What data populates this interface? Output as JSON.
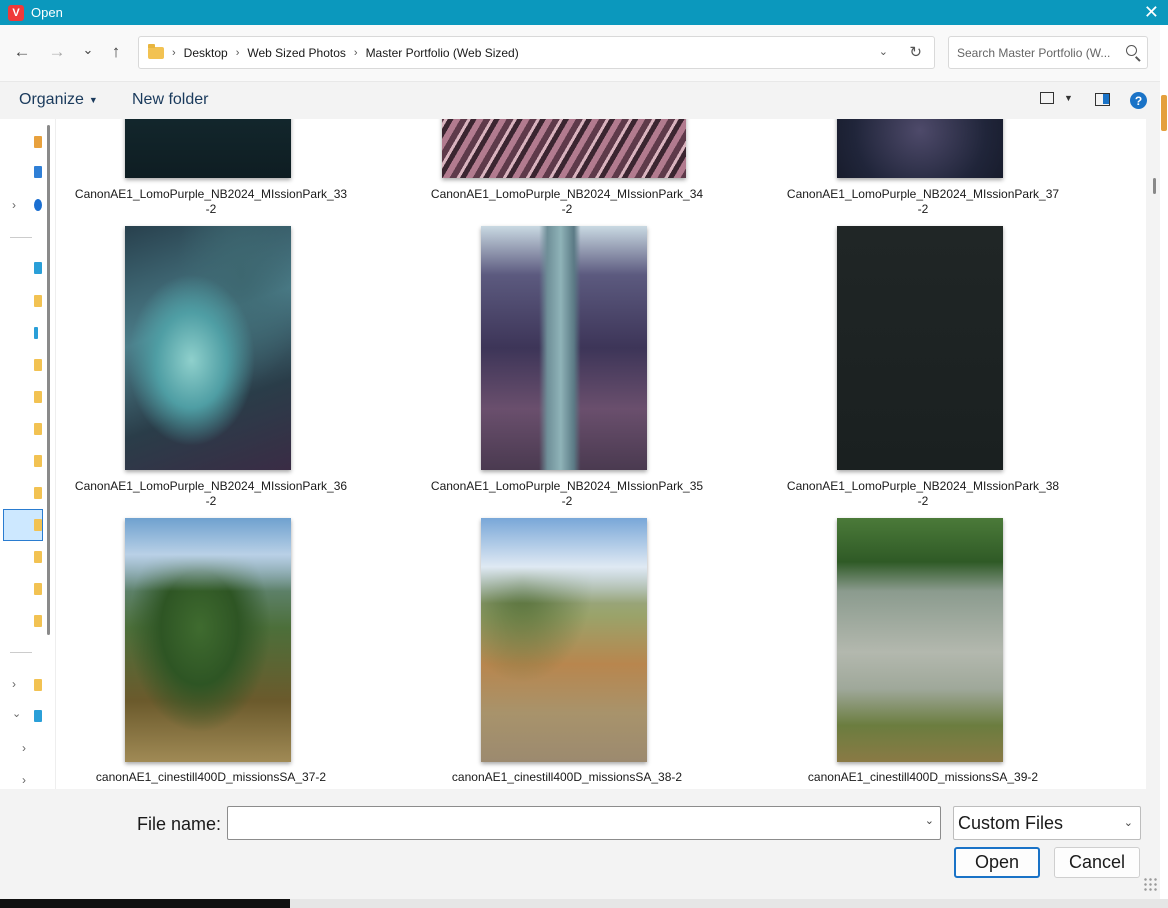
{
  "window": {
    "title": "Open",
    "app_icon": "V"
  },
  "nav": {
    "back_glyph": "←",
    "forward_glyph": "→",
    "recent_glyph": "⌄",
    "up_glyph": "↑",
    "breadcrumbs": [
      "Desktop",
      "Web Sized Photos",
      "Master Portfolio (Web Sized)"
    ],
    "search_placeholder": "Search Master Portfolio (W..."
  },
  "commands": {
    "organize": "Organize",
    "new_folder": "New folder",
    "help": "?"
  },
  "files": [
    {
      "name": "CanonAE1_LomoPurple_NB2024_MIssionPark_33",
      "suffix": "-2",
      "thumb": "t-dark1"
    },
    {
      "name": "CanonAE1_LomoPurple_NB2024_MIssionPark_34",
      "suffix": "-2",
      "thumb": "t-bark"
    },
    {
      "name": "CanonAE1_LomoPurple_NB2024_MIssionPark_37",
      "suffix": "-2",
      "thumb": "t-dark2"
    },
    {
      "name": "CanonAE1_LomoPurple_NB2024_MIssionPark_36",
      "suffix": "-2",
      "thumb": "t-cactus"
    },
    {
      "name": "CanonAE1_LomoPurple_NB2024_MIssionPark_35",
      "suffix": "-2",
      "thumb": "t-tree"
    },
    {
      "name": "CanonAE1_LomoPurple_NB2024_MIssionPark_38",
      "suffix": "-2",
      "thumb": "t-black"
    },
    {
      "name": "canonAE1_cinestill400D_missionsSA_37-2",
      "suffix": "",
      "thumb": "t-park1"
    },
    {
      "name": "canonAE1_cinestill400D_missionsSA_38-2",
      "suffix": "",
      "thumb": "t-park2"
    },
    {
      "name": "canonAE1_cinestill400D_missionsSA_39-2",
      "suffix": "",
      "thumb": "t-pond"
    }
  ],
  "footer": {
    "file_name_label": "File name:",
    "file_name_value": "",
    "file_type": "Custom Files",
    "open_label": "Open",
    "cancel_label": "Cancel"
  },
  "colors": {
    "titlebar": "#0b98bd",
    "accent": "#1a73c7"
  }
}
